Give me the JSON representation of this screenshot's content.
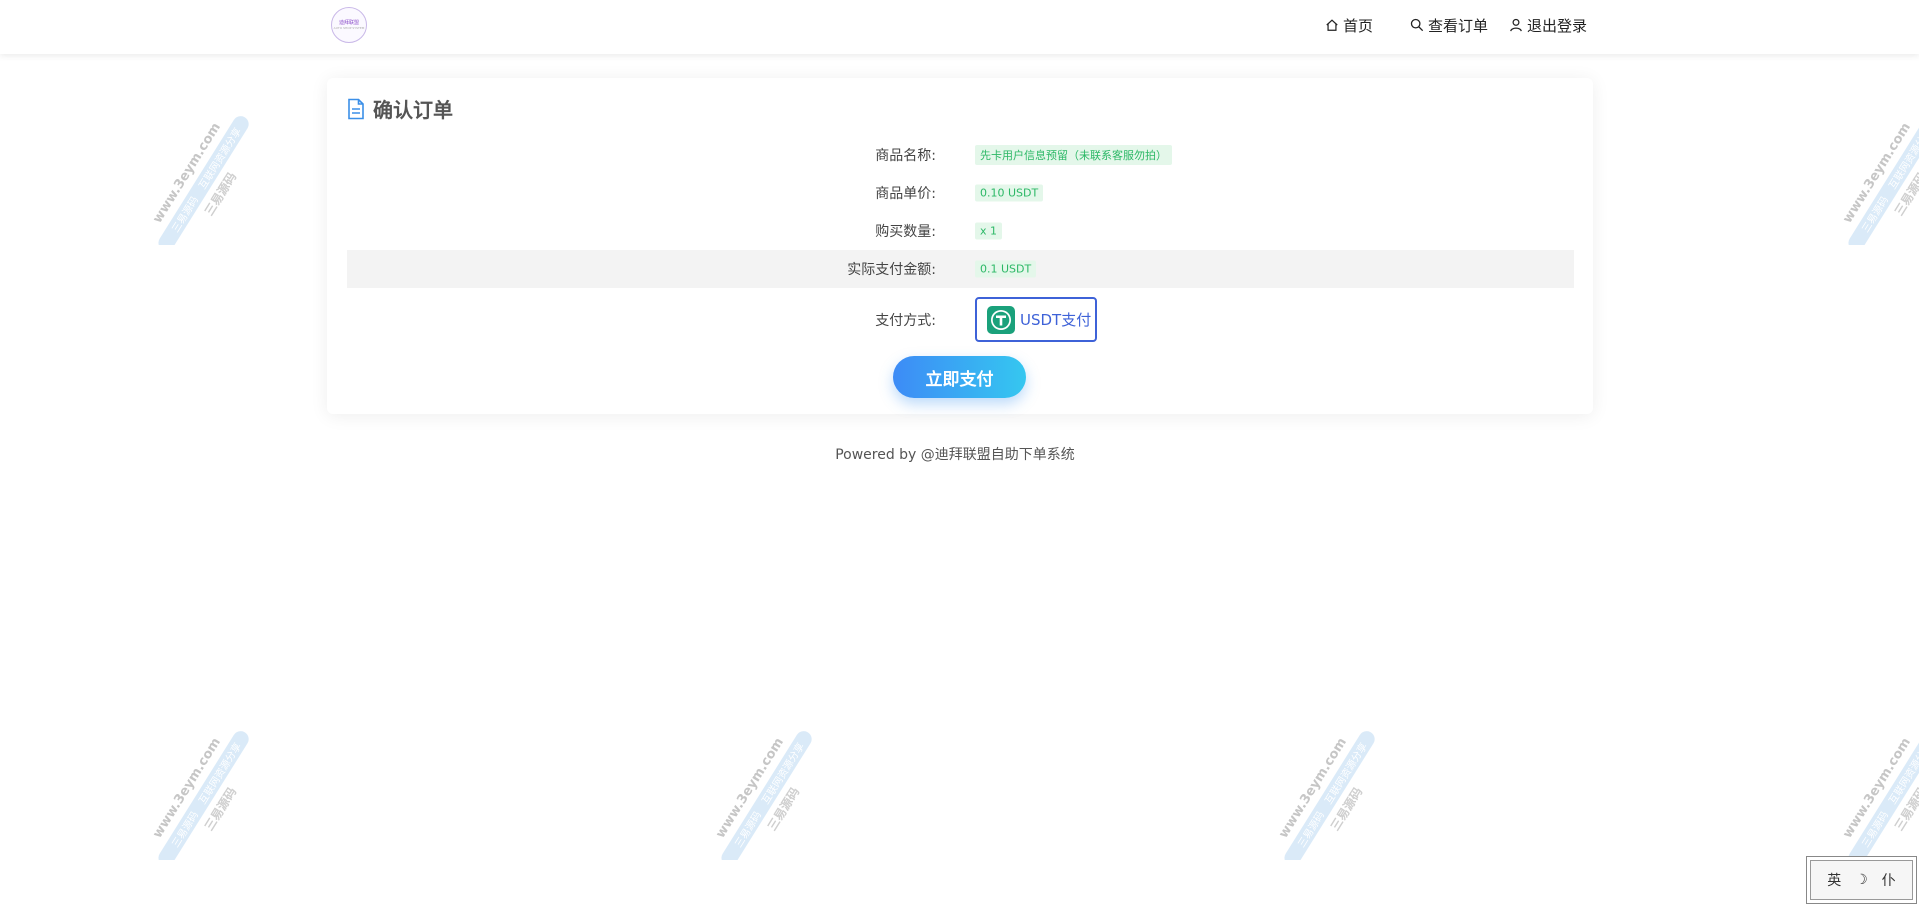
{
  "header": {
    "logo_text": "迪拜联盟",
    "logo_subtext": "AUTO SHOP SYSTEM",
    "nav": [
      {
        "label": "首页",
        "icon": "home-icon"
      },
      {
        "label": "查看订单",
        "icon": "search-icon"
      },
      {
        "label": "退出登录",
        "icon": "user-icon"
      }
    ]
  },
  "card": {
    "title": "确认订单",
    "rows": [
      {
        "label": "商品名称:",
        "value": "先卡用户信息预留（未联系客服勿拍）"
      },
      {
        "label": "商品单价:",
        "value": "0.10 USDT"
      },
      {
        "label": "购买数量:",
        "value": "x 1"
      },
      {
        "label": "实际支付金额:",
        "value": "0.1 USDT"
      }
    ],
    "payment": {
      "label": "支付方式:",
      "option": "USDT支付",
      "coin_letter": "T"
    },
    "pay_button": "立即支付"
  },
  "footer": {
    "text": "Powered by @迪拜联盟自助下单系统"
  },
  "corner_stamp": {
    "chars": [
      "英",
      "☽",
      "仆"
    ]
  },
  "watermark": {
    "line1": "www.3eym.com",
    "line2": "三易源码",
    "line3": "互联网资源分享"
  },
  "colors": {
    "accent": "#3e62d8",
    "tag_text": "#2cb866",
    "tag_bg": "#e4f7ea",
    "button_gradient_start": "#3d8bf6",
    "button_gradient_end": "#35c7f0",
    "usdt_green": "#1aa17b"
  }
}
